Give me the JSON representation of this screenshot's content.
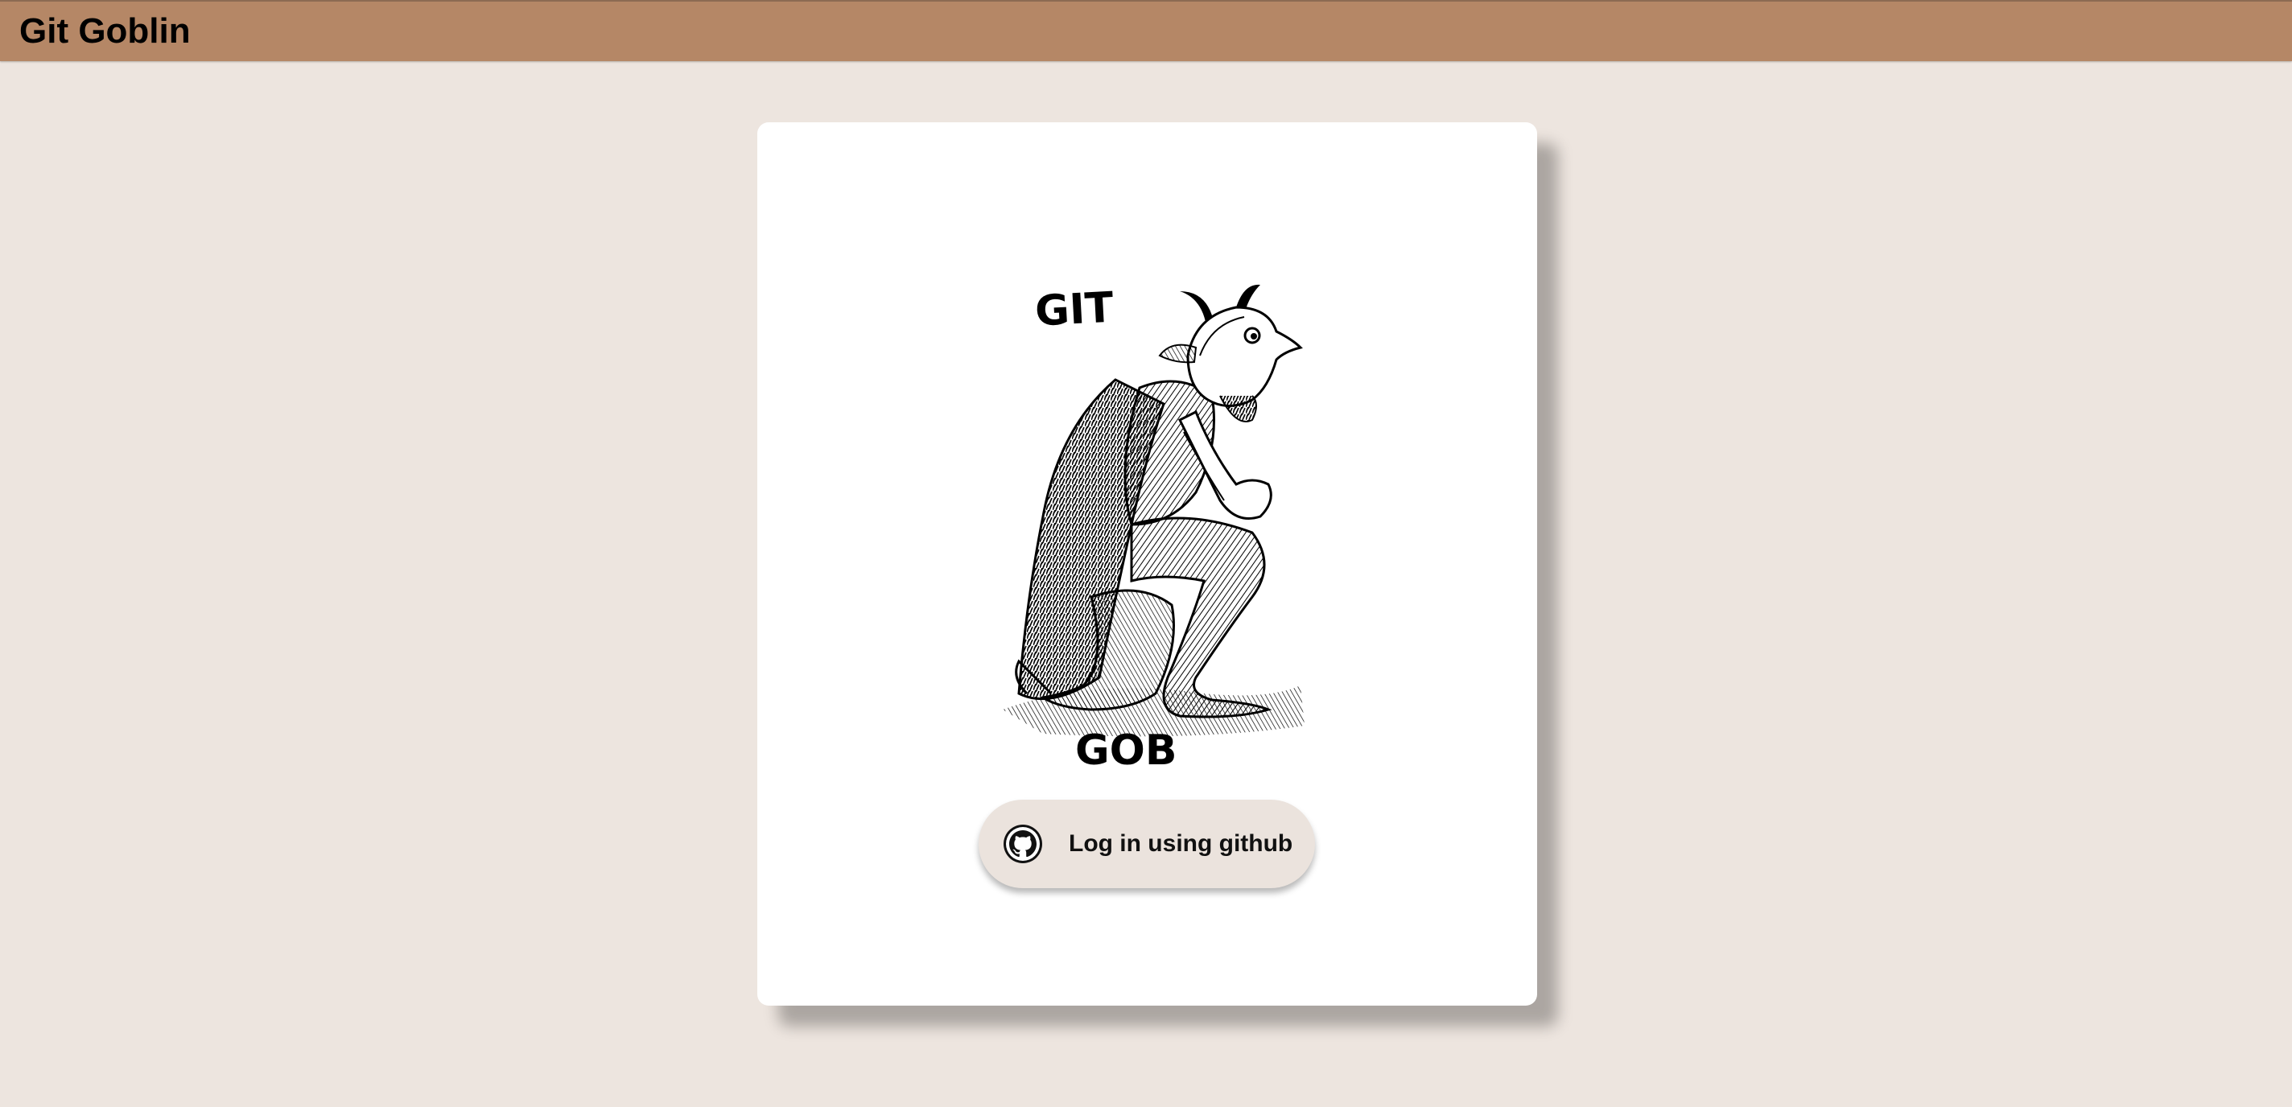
{
  "header": {
    "title": "Git Goblin"
  },
  "logo": {
    "text_top": "GIT",
    "text_bottom": "GOB"
  },
  "login": {
    "label": "Log in using github",
    "icon": "github-icon"
  },
  "colors": {
    "background": "#ede5df",
    "header_bar": "#b58766",
    "card": "#ffffff",
    "button": "#ebe3dd"
  }
}
